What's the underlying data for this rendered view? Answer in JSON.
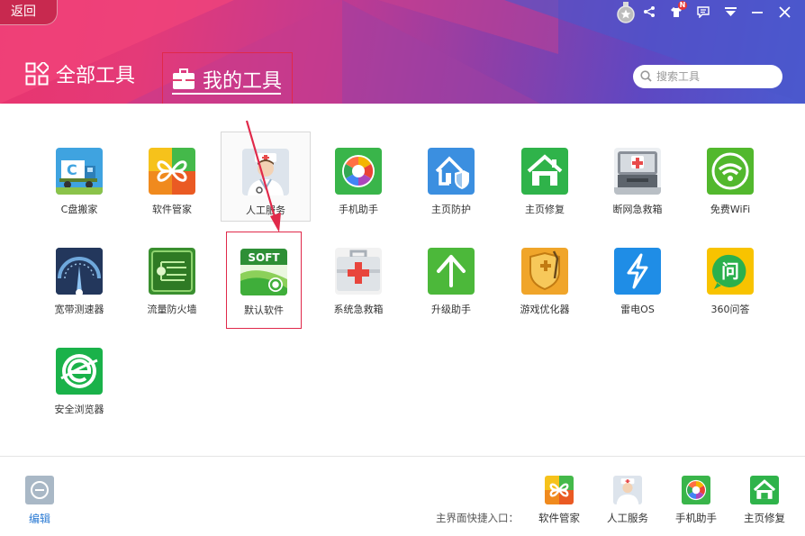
{
  "header": {
    "back_label": "返回",
    "tabs": [
      {
        "label": "全部工具",
        "active": false
      },
      {
        "label": "我的工具",
        "active": true
      }
    ],
    "search_placeholder": "搜索工具",
    "notification_badge": "N"
  },
  "tools": [
    {
      "label": "C盘搬家",
      "icon": "truck-c-icon"
    },
    {
      "label": "软件管家",
      "icon": "butterfly-icon"
    },
    {
      "label": "人工服务",
      "icon": "nurse-icon"
    },
    {
      "label": "手机助手",
      "icon": "colorwheel-icon"
    },
    {
      "label": "主页防护",
      "icon": "home-shield-icon"
    },
    {
      "label": "主页修复",
      "icon": "home-fix-icon"
    },
    {
      "label": "断网急救箱",
      "icon": "network-firstaid-icon"
    },
    {
      "label": "免费WiFi",
      "icon": "wifi-icon"
    },
    {
      "label": "宽带测速器",
      "icon": "speedometer-icon"
    },
    {
      "label": "流量防火墙",
      "icon": "circuit-icon"
    },
    {
      "label": "默认软件",
      "icon": "soft-gear-icon",
      "badge_text": "SOFT"
    },
    {
      "label": "系统急救箱",
      "icon": "firstaid-icon"
    },
    {
      "label": "升级助手",
      "icon": "up-arrow-icon"
    },
    {
      "label": "游戏优化器",
      "icon": "game-shield-icon"
    },
    {
      "label": "雷电OS",
      "icon": "lightning-icon"
    },
    {
      "label": "360问答",
      "icon": "qa-icon",
      "badge_text": "问"
    },
    {
      "label": "安全浏览器",
      "icon": "browser-e-icon"
    }
  ],
  "footer": {
    "edit_label": "编辑",
    "quick_label": "主界面快捷入口：",
    "quick_items": [
      {
        "label": "软件管家",
        "icon": "butterfly-icon"
      },
      {
        "label": "人工服务",
        "icon": "nurse-icon"
      },
      {
        "label": "手机助手",
        "icon": "colorwheel-icon"
      },
      {
        "label": "主页修复",
        "icon": "home-fix-icon"
      }
    ]
  },
  "colors": {
    "highlight_box": "#e0294a",
    "edit_link": "#2a7ad3"
  }
}
